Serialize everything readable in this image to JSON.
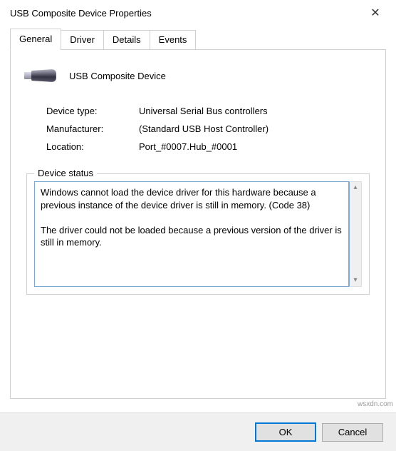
{
  "window": {
    "title": "USB Composite Device Properties",
    "close_glyph": "✕"
  },
  "tabs": {
    "general": "General",
    "driver": "Driver",
    "details": "Details",
    "events": "Events"
  },
  "device": {
    "name": "USB Composite Device"
  },
  "info": {
    "type_label": "Device type:",
    "type_value": "Universal Serial Bus controllers",
    "manufacturer_label": "Manufacturer:",
    "manufacturer_value": "(Standard USB Host Controller)",
    "location_label": "Location:",
    "location_value": "Port_#0007.Hub_#0001"
  },
  "status": {
    "legend": "Device status",
    "text": "Windows cannot load the device driver for this hardware because a previous instance of the device driver is still in memory. (Code 38)\n\nThe driver could not be loaded because a previous version of the driver is still in memory."
  },
  "buttons": {
    "ok": "OK",
    "cancel": "Cancel"
  },
  "watermark": "wsxdn.com"
}
